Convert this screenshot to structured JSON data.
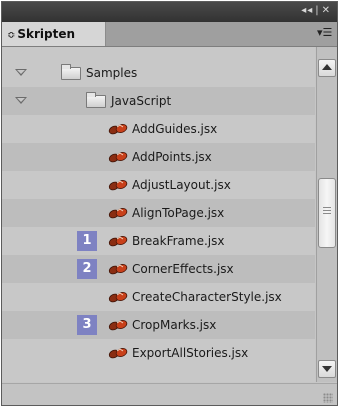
{
  "panel": {
    "tab_label": "Skripten",
    "tab_arrows": "≎",
    "title_controls": [
      "◂◂",
      "|",
      "✕"
    ],
    "menu_icon_glyph": "▾☰"
  },
  "tree": {
    "folders": [
      {
        "label": "Samples",
        "expanded": true
      },
      {
        "label": "JavaScript",
        "expanded": true
      }
    ],
    "scripts": [
      {
        "label": "AddGuides.jsx",
        "badge": ""
      },
      {
        "label": "AddPoints.jsx",
        "badge": ""
      },
      {
        "label": "AdjustLayout.jsx",
        "badge": ""
      },
      {
        "label": "AlignToPage.jsx",
        "badge": ""
      },
      {
        "label": "BreakFrame.jsx",
        "badge": "1"
      },
      {
        "label": "CornerEffects.jsx",
        "badge": "2"
      },
      {
        "label": "CreateCharacterStyle.jsx",
        "badge": ""
      },
      {
        "label": "CropMarks.jsx",
        "badge": "3"
      },
      {
        "label": "ExportAllStories.jsx",
        "badge": ""
      }
    ]
  },
  "colors": {
    "badge": "#7e82c2",
    "titlebar": "#3a3a3a",
    "row_alt": "#bdbdbd",
    "row_plain": "#c8c8c8"
  },
  "icons": {
    "script": "script-icon",
    "folder": "folder-icon",
    "expand": "disclosure-triangle-icon"
  }
}
